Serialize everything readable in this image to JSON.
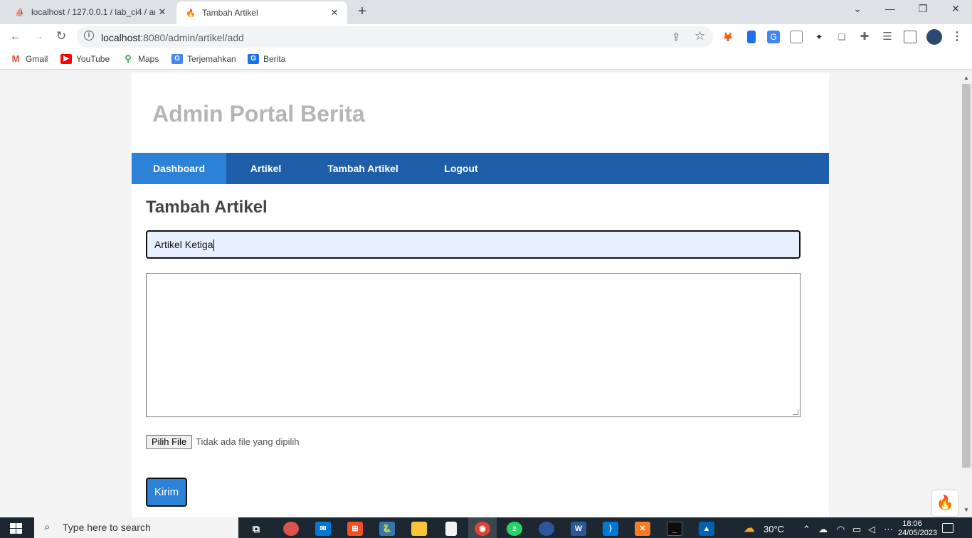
{
  "browser": {
    "tabs": [
      {
        "title": "localhost / 127.0.0.1 / lab_ci4 / ar",
        "favicon": "phpmyadmin-icon",
        "active": false
      },
      {
        "title": "Tambah Artikel",
        "favicon": "codeigniter-flame-icon",
        "active": true
      }
    ],
    "new_tab": "+",
    "window_controls": {
      "dropdown": "⌄",
      "minimize": "—",
      "restore": "❐",
      "close": "✕"
    },
    "url": "localhost:8080/admin/artikel/add",
    "url_host": "localhost",
    "url_rest": ":8080/admin/artikel/add",
    "bookmarks": [
      {
        "label": "Gmail",
        "icon": "gmail-icon"
      },
      {
        "label": "YouTube",
        "icon": "youtube-icon"
      },
      {
        "label": "Maps",
        "icon": "maps-icon"
      },
      {
        "label": "Terjemahkan",
        "icon": "translate-icon"
      },
      {
        "label": "Berita",
        "icon": "news-icon"
      }
    ]
  },
  "page": {
    "site_title": "Admin Portal Berita",
    "nav": [
      {
        "label": "Dashboard",
        "active": true
      },
      {
        "label": "Artikel",
        "active": false
      },
      {
        "label": "Tambah Artikel",
        "active": false
      },
      {
        "label": "Logout",
        "active": false
      }
    ],
    "heading": "Tambah Artikel",
    "form": {
      "title_value": "Artikel Ketiga",
      "content_value": "",
      "file_button": "Pilih File",
      "file_status": "Tidak ada file yang dipilih",
      "submit_label": "Kirim"
    }
  },
  "taskbar": {
    "search_placeholder": "Type here to search",
    "temperature": "30°C",
    "time": "18:06",
    "date": "24/05/2023",
    "whatsapp_badge": "2"
  },
  "colors": {
    "nav_bg": "#1f5faa",
    "nav_active": "#2b82d6",
    "site_title": "#b5b5b5",
    "input_bg": "#e8f0fe"
  }
}
